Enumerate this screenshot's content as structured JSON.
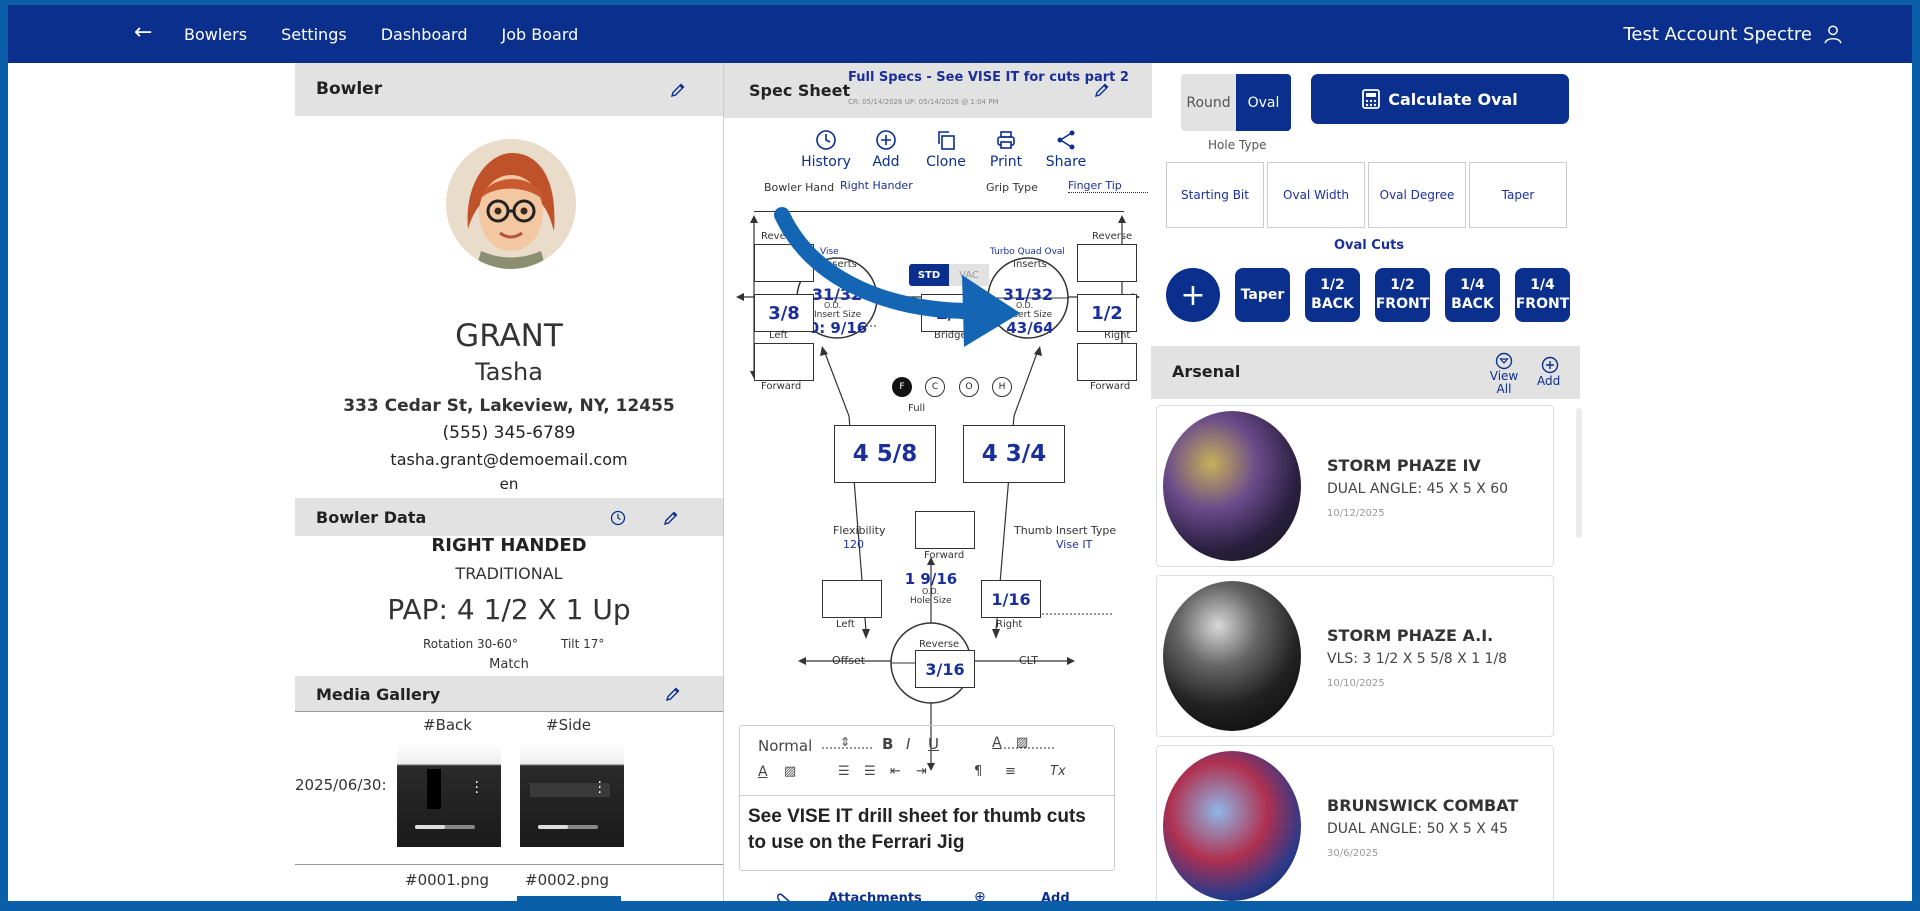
{
  "nav": {
    "items": [
      "Bowlers",
      "Settings",
      "Dashboard",
      "Job Board"
    ],
    "account": "Test Account Spectre"
  },
  "bowler": {
    "section_title": "Bowler",
    "last_name": "GRANT",
    "first_name": "Tasha",
    "address": "333 Cedar St, Lakeview, NY, 12455",
    "phone": "(555) 345-6789",
    "email": "tasha.grant@demoemail.com",
    "language": "en"
  },
  "bowler_data": {
    "section_title": "Bowler Data",
    "handed": "RIGHT HANDED",
    "style": "TRADITIONAL",
    "pap": "PAP: 4 1/2 X 1 Up",
    "rotation": "Rotation 30-60°",
    "tilt": "Tilt 17°",
    "match": "Match"
  },
  "media": {
    "section_title": "Media Gallery",
    "date": "2025/06/30:",
    "items": [
      {
        "tag": "#Back",
        "file": "#0001.png"
      },
      {
        "tag": "#Side",
        "file": "#0002.png"
      }
    ]
  },
  "spec": {
    "section_title": "Spec Sheet",
    "full_specs": "Full Specs - See VISE IT for cuts part 2",
    "meta": "CR: 05/14/2026 UP: 05/14/2026 @ 1:04 PM",
    "toolbar": [
      "History",
      "Add",
      "Clone",
      "Print",
      "Share"
    ],
    "bowler_hand_label": "Bowler Hand",
    "bowler_hand_value": "Right Hander",
    "grip_type_label": "Grip Type",
    "grip_type_value": "Finger Tip",
    "reverse": "Reverse",
    "forward": "Forward",
    "left": "Left",
    "right": "Right",
    "bridge": "Bridge",
    "inserts": "Inserts",
    "left_insert_type": "Vise",
    "right_insert_type": "Turbo Quad Oval",
    "std": "STD",
    "vac": "VAC",
    "left_od": "31/32",
    "right_od": "31/32",
    "od_label": "O.D.",
    "insert_size_label": "Insert Size",
    "left_insert_size": "0: 9/16",
    "right_insert_size": "43/64",
    "left_pitch": "3/8",
    "bridge_value": "1/4",
    "right_pitch": "1/2",
    "grip_options": [
      "F",
      "C",
      "O",
      "H"
    ],
    "full": "Full",
    "left_span": "4 5/8",
    "right_span": "4 3/4",
    "flexibility_label": "Flexibility",
    "flexibility_value": "120",
    "thumb_insert_label": "Thumb Insert Type",
    "thumb_insert_value": "Vise IT",
    "thumb_od": "1 9/16",
    "hole_size_label": "Hole Size",
    "thumb_right": "1/16",
    "thumb_reverse": "3/16",
    "offset": "Offset",
    "clt": "CLT",
    "editor_format": "Normal",
    "editor_text": "See VISE IT drill sheet for thumb cuts to use on the Ferrari Jig",
    "attachments": "Attachments",
    "add": "Add"
  },
  "hole": {
    "round": "Round",
    "oval": "Oval",
    "calc": "Calculate Oval",
    "hole_type": "Hole Type",
    "options": [
      "Starting Bit",
      "Oval Width",
      "Oval Degree",
      "Taper"
    ],
    "oval_cuts": "Oval Cuts",
    "cuts": [
      "Taper",
      "1/2 BACK",
      "1/2 FRONT",
      "1/4 BACK",
      "1/4 FRONT"
    ]
  },
  "arsenal": {
    "section_title": "Arsenal",
    "view_all": "View All",
    "add": "Add",
    "balls": [
      {
        "name": "STORM PHAZE IV",
        "spec": "DUAL ANGLE: 45 X 5 X 60",
        "date": "10/12/2025"
      },
      {
        "name": "STORM PHAZE A.I.",
        "spec": "VLS: 3 1/2 X 5 5/8 X 1 1/8",
        "date": "10/10/2025"
      },
      {
        "name": "BRUNSWICK COMBAT",
        "spec": "DUAL ANGLE: 50 X 5 X 45",
        "date": "30/6/2025"
      }
    ]
  }
}
